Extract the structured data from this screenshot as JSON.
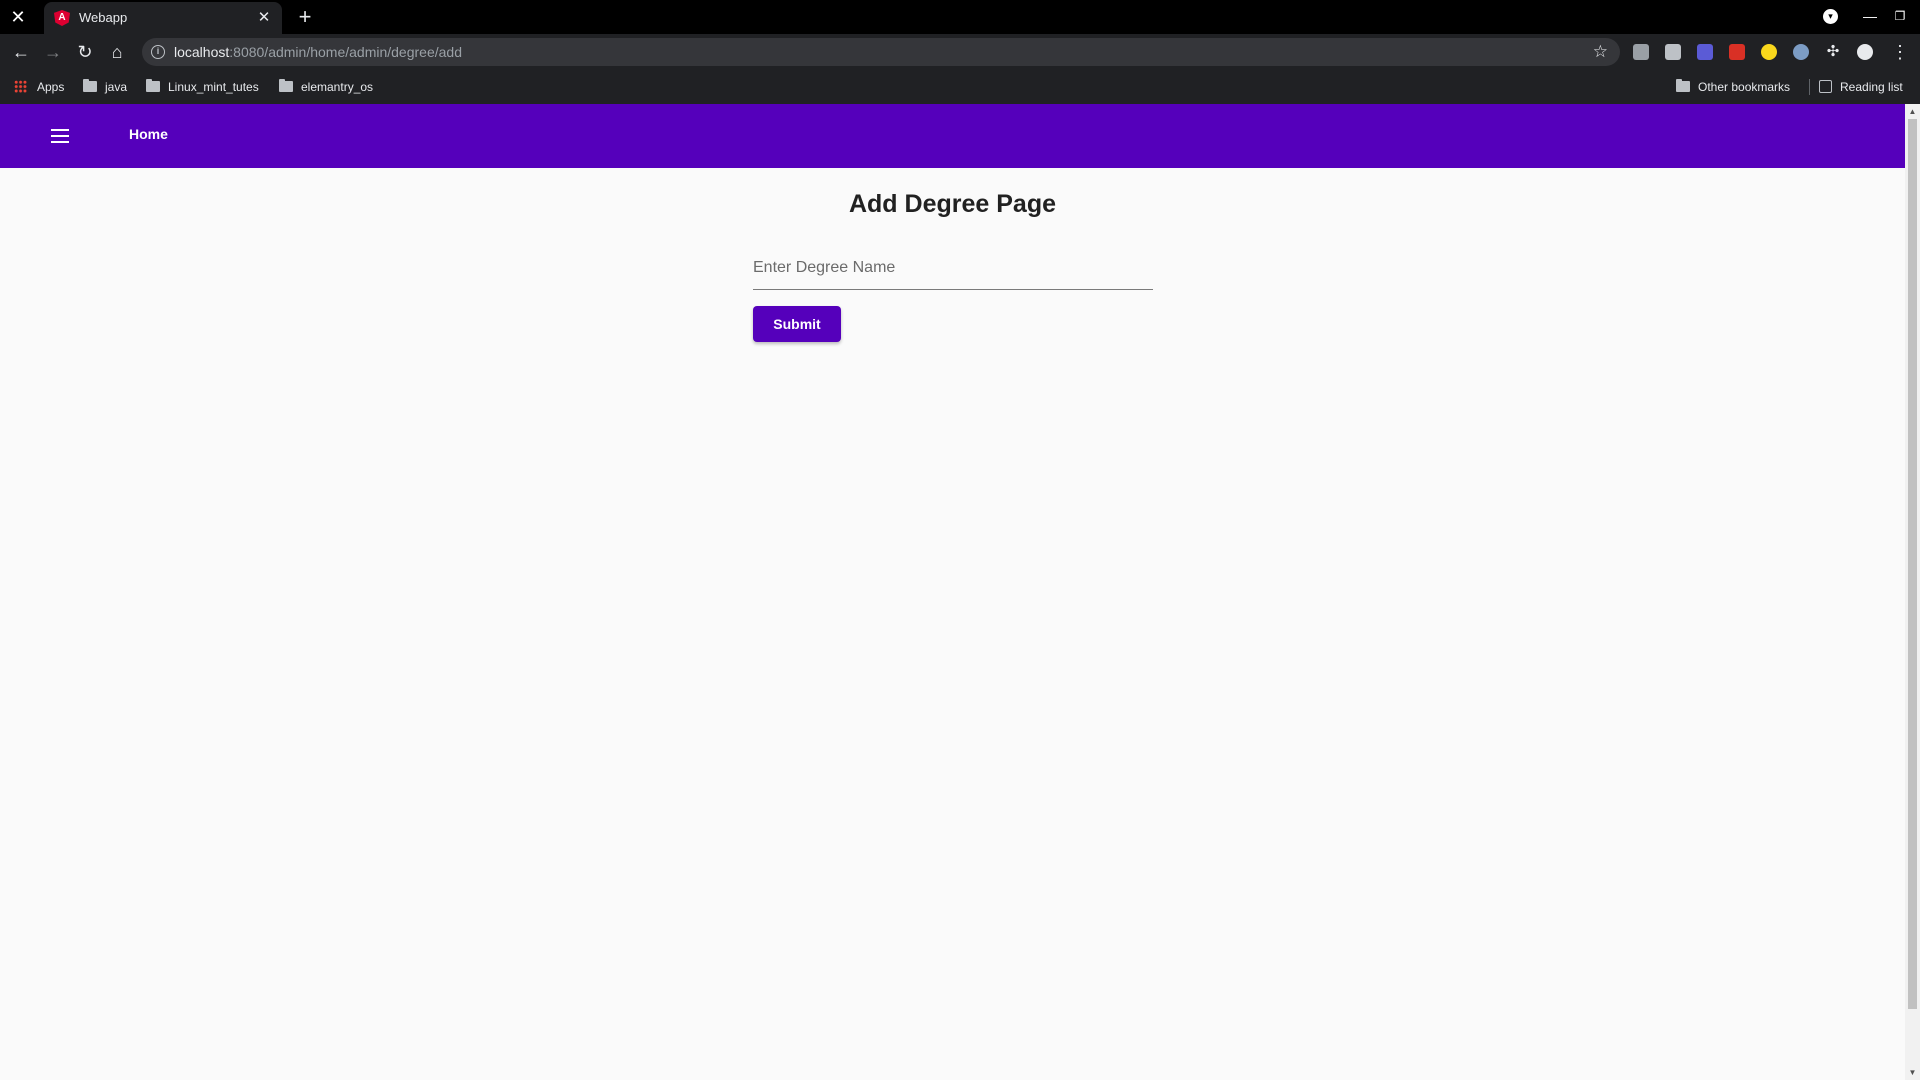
{
  "browser": {
    "tab_title": "Webapp",
    "url_host": "localhost",
    "url_rest": ":8080/admin/home/admin/degree/add",
    "bookmarks": [
      "Apps",
      "java",
      "Linux_mint_tutes",
      "elemantry_os"
    ],
    "other_bookmarks": "Other bookmarks",
    "reading_list": "Reading list"
  },
  "app": {
    "brand_color": "#5500bb",
    "nav_home": "Home",
    "page_title": "Add Degree Page",
    "degree_placeholder": "Enter Degree Name",
    "submit_label": "Submit"
  }
}
